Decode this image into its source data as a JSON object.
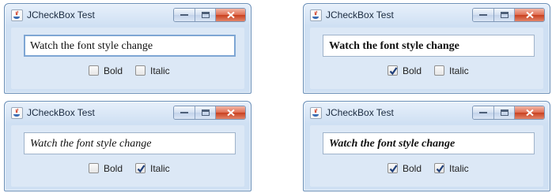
{
  "windows": [
    {
      "title": "JCheckBox Test",
      "text": "Watch the font style change",
      "bold": false,
      "italic": false,
      "bold_label": "Bold",
      "italic_label": "Italic",
      "text_focused": true
    },
    {
      "title": "JCheckBox Test",
      "text": "Watch the font style change",
      "bold": true,
      "italic": false,
      "bold_label": "Bold",
      "italic_label": "Italic",
      "text_focused": false
    },
    {
      "title": "JCheckBox Test",
      "text": "Watch the font style change",
      "bold": false,
      "italic": true,
      "bold_label": "Bold",
      "italic_label": "Italic",
      "text_focused": false
    },
    {
      "title": "JCheckBox Test",
      "text": "Watch the font style change",
      "bold": true,
      "italic": true,
      "bold_label": "Bold",
      "italic_label": "Italic",
      "text_focused": false
    }
  ],
  "icons": {
    "app": "java-icon",
    "minimize": "minimize-icon",
    "maximize": "maximize-icon",
    "close": "close-icon",
    "check": "checkmark-icon"
  },
  "colors": {
    "window_frame": "#cfe0f3",
    "close_button": "#c9401f",
    "checkmark": "#1f3f7a"
  }
}
